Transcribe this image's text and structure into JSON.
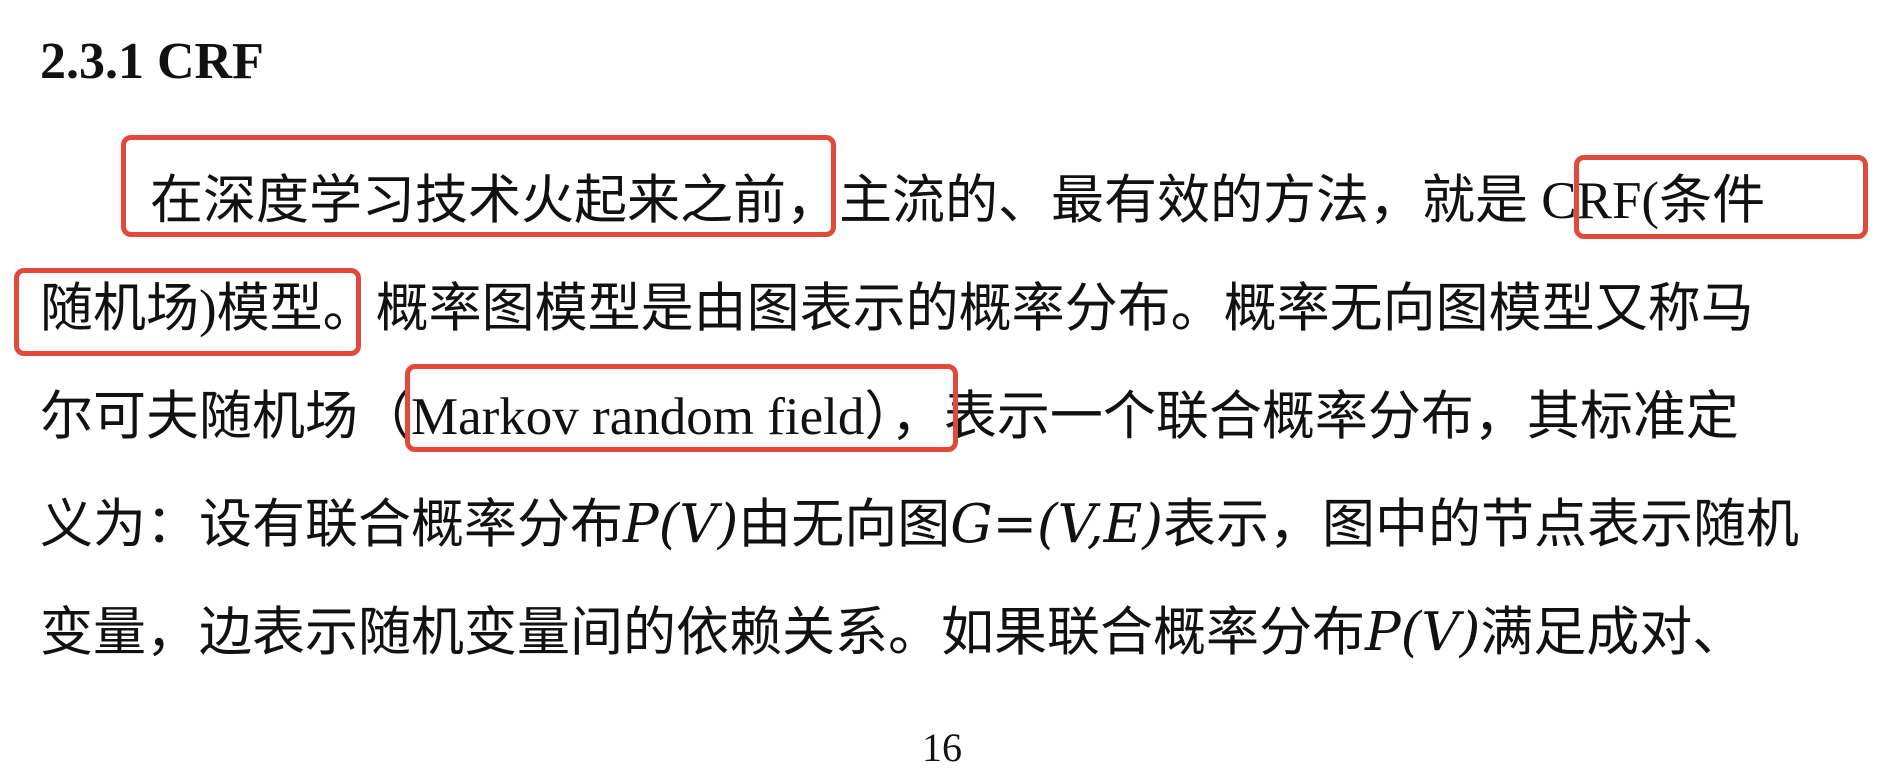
{
  "section": {
    "heading": "2.3.1 CRF"
  },
  "paragraph": {
    "line1": "在深度学习技术火起来之前，主流的、最有效的方法，就是 CRF(条件",
    "line2": "随机场)模型。概率图模型是由图表示的概率分布。概率无向图模型又称马",
    "line3": "尔可夫随机场（Markov random field），表示一个联合概率分布，其标准定",
    "line4_a": "义为：设有联合概率分布",
    "line4_math1": "P(V)",
    "line4_b": "由无向图",
    "line4_math2": "G=(V,E)",
    "line4_c": "表示，图中的节点表示随机",
    "line5_a": "变量，边表示随机变量间的依赖关系。如果联合概率分布",
    "line5_math": "P(V)",
    "line5_b": "满足成对、"
  },
  "page_number": "16",
  "highlight_color": "#e04a3a"
}
